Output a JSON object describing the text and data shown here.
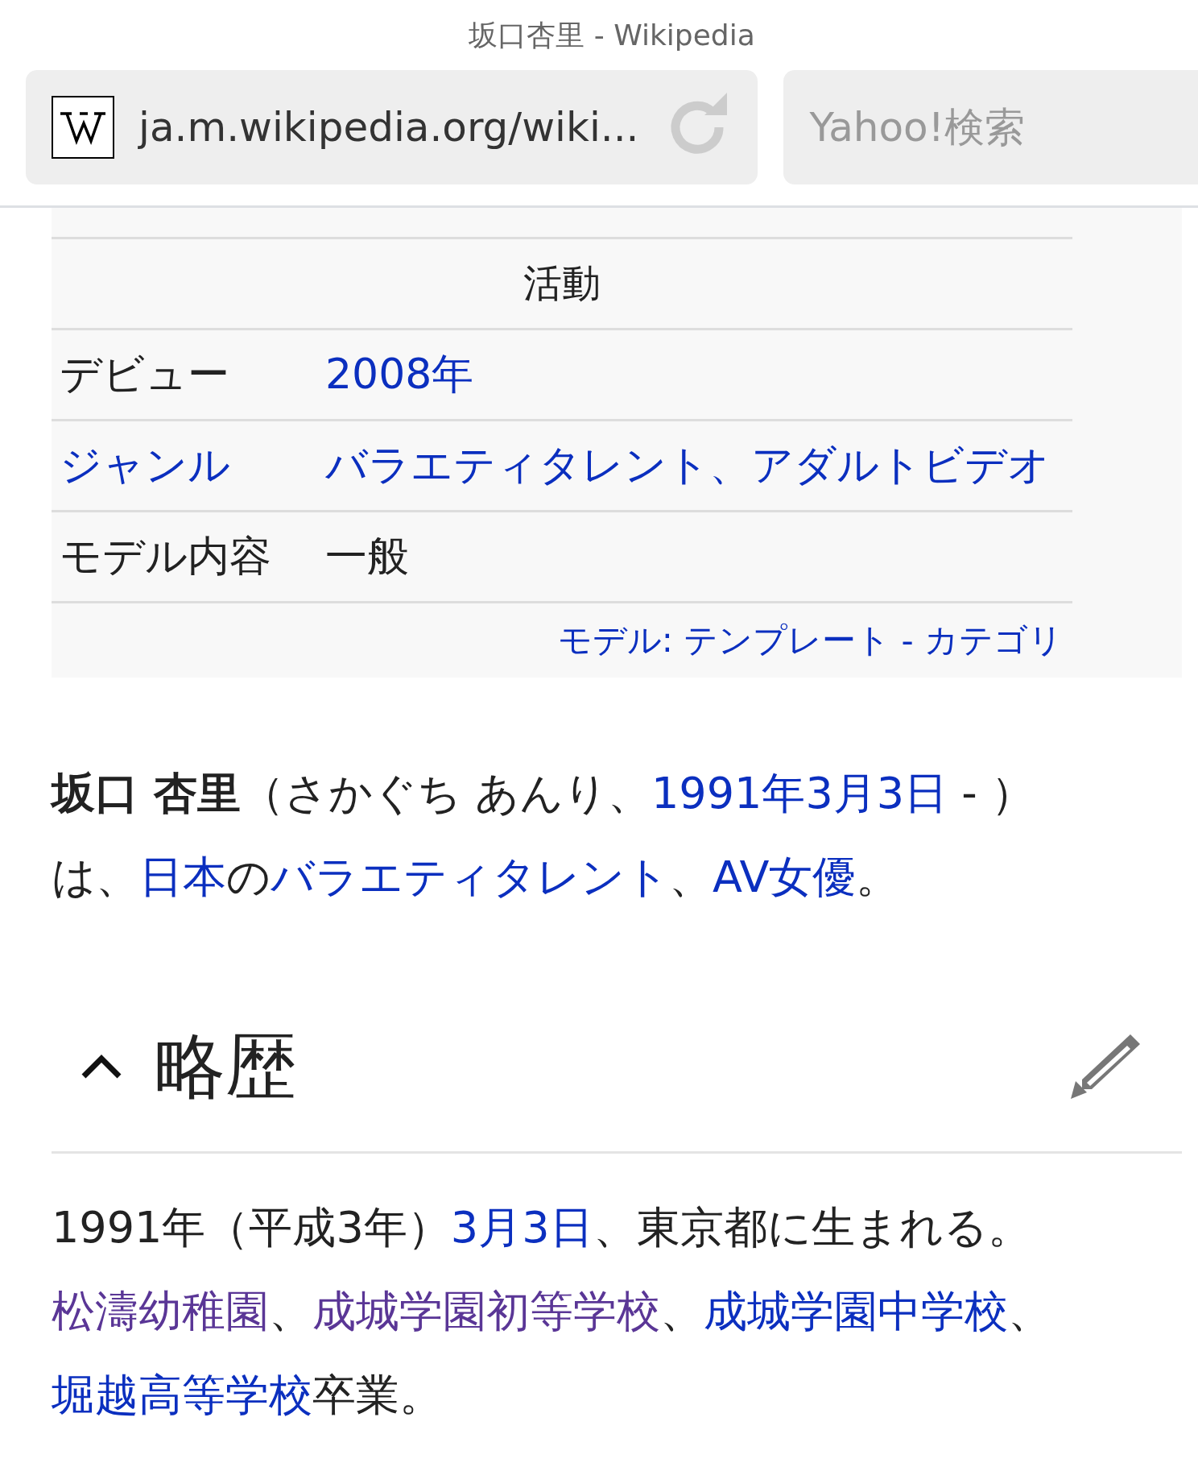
{
  "browser": {
    "page_title": "坂口杏里 - Wikipedia",
    "url": "ja.m.wikipedia.org/wiki...",
    "search": {
      "placeholder": "Yahoo!検索"
    }
  },
  "infobox": {
    "section_header": "活動",
    "rows": [
      {
        "label": "デビュー",
        "label_link": false,
        "value": "2008年",
        "value_link": true
      },
      {
        "label": "ジャンル",
        "label_link": true,
        "value": "バラエティタレント、アダルトビデオ",
        "value_link": true
      },
      {
        "label": "モデル内容",
        "label_link": false,
        "value": "一般",
        "value_link": false
      }
    ],
    "footer_links": [
      {
        "text": "モデル: テンプレート",
        "kind": "link"
      },
      {
        "text": " - ",
        "kind": "text"
      },
      {
        "text": "カテゴリ",
        "kind": "link"
      }
    ]
  },
  "lead": {
    "lines": [
      [
        {
          "text": "坂口 杏里",
          "kind": "bold"
        },
        {
          "text": "（さかぐち あんり、",
          "kind": "text"
        },
        {
          "text": "1991年3月3日",
          "kind": "link"
        },
        {
          "text": " - ）",
          "kind": "text"
        }
      ],
      [
        {
          "text": "は、",
          "kind": "text"
        },
        {
          "text": "日本",
          "kind": "link"
        },
        {
          "text": "の",
          "kind": "text"
        },
        {
          "text": "バラエティタレント",
          "kind": "link"
        },
        {
          "text": "、",
          "kind": "text"
        },
        {
          "text": "AV女優",
          "kind": "link"
        },
        {
          "text": "。",
          "kind": "text"
        }
      ]
    ]
  },
  "section": {
    "title": "略歴",
    "expanded": true,
    "lines": [
      [
        {
          "text": "1991年（平成3年）",
          "kind": "text"
        },
        {
          "text": "3月3日",
          "kind": "link"
        },
        {
          "text": "、東京都に生まれる。",
          "kind": "text"
        }
      ],
      [
        {
          "text": "松濤幼稚園",
          "kind": "visited"
        },
        {
          "text": "、",
          "kind": "text"
        },
        {
          "text": "成城学園初等学校",
          "kind": "visited"
        },
        {
          "text": "、",
          "kind": "text"
        },
        {
          "text": "成城学園中学校",
          "kind": "link"
        },
        {
          "text": "、",
          "kind": "text"
        }
      ],
      [
        {
          "text": "堀越高等学校",
          "kind": "link"
        },
        {
          "text": "卒業。",
          "kind": "text"
        }
      ]
    ]
  }
}
